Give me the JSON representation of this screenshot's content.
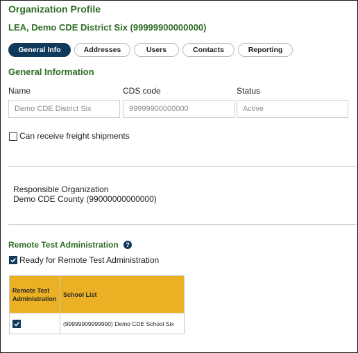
{
  "page": {
    "title": "Organization Profile",
    "org_name": "LEA, Demo CDE District Six (99999900000000)"
  },
  "tabs": [
    {
      "label": "General Info",
      "active": true
    },
    {
      "label": "Addresses",
      "active": false
    },
    {
      "label": "Users",
      "active": false
    },
    {
      "label": "Contacts",
      "active": false
    },
    {
      "label": "Reporting",
      "active": false
    }
  ],
  "general": {
    "heading": "General Information",
    "name_label": "Name",
    "name_value": "Demo CDE District Six",
    "cds_label": "CDS code",
    "cds_value": "99999900000000",
    "status_label": "Status",
    "status_value": "Active",
    "freight_label": "Can receive freight shipments",
    "freight_checked": false
  },
  "responsible": {
    "label": "Responsible Organization",
    "value": "Demo CDE County (99000000000000)"
  },
  "remote": {
    "heading": "Remote Test Administration",
    "help_glyph": "?",
    "ready_label": "Ready for Remote Test Administration",
    "ready_checked": true,
    "table": {
      "col1_header": "Remote Test Administration",
      "col2_header": "School List",
      "rows": [
        {
          "checked": true,
          "school": "(99999909999990) Demo CDE School Six"
        }
      ]
    }
  },
  "colors": {
    "brand_green": "#2e6b25",
    "navy": "#0f3a5c",
    "table_header": "#ebb125"
  },
  "icons": {
    "help": "question-circle-icon",
    "check": "checkmark-icon"
  }
}
